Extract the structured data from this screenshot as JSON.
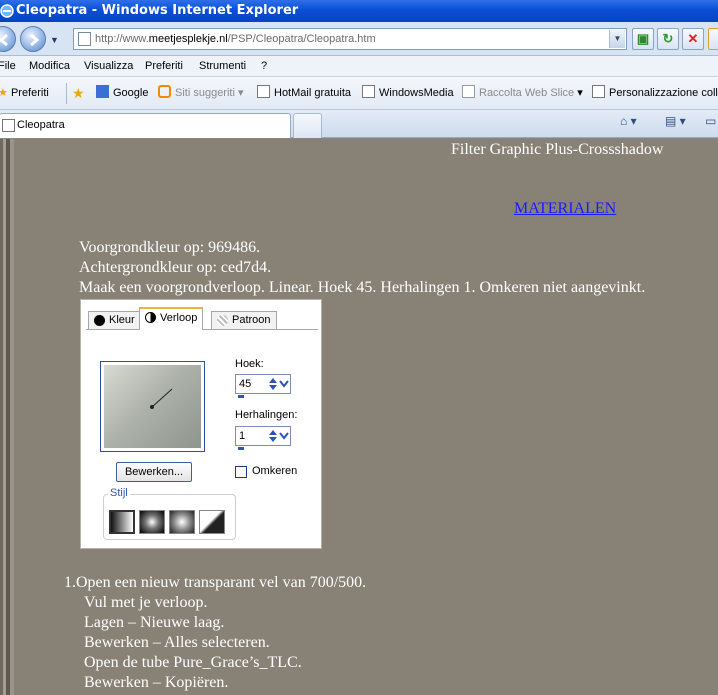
{
  "window": {
    "title": "Cleopatra - Windows Internet Explorer"
  },
  "address": {
    "prefix": "http://www.",
    "host": "meetjesplekje.nl",
    "path": "/PSP/Cleopatra/Cleopatra.htm"
  },
  "menu": [
    "File",
    "Modifica",
    "Visualizza",
    "Preferiti",
    "Strumenti",
    "?"
  ],
  "favorites": {
    "label": "Preferiti",
    "items": [
      "Google",
      "Siti suggeriti",
      "HotMail gratuita",
      "WindowsMedia",
      "Raccolta Web Slice",
      "Personalizzazione colle"
    ]
  },
  "tab": {
    "title": "Cleopatra"
  },
  "page": {
    "header": "Filter Graphic  Plus-Crossshadow",
    "materials_link": "MATERIALEN",
    "intro": [
      "Voorgrondkleur op: 969486.",
      "Achtergrondkleur op: ced7d4.",
      "Maak een voorgrondverloop. Linear. Hoek 45. Herhalingen 1. Omkeren niet aangevinkt."
    ],
    "dialog": {
      "tabs": [
        "Kleur",
        "Verloop",
        "Patroon"
      ],
      "angle_label": "Hoek:",
      "angle_value": "45",
      "repeats_label": "Herhalingen:",
      "repeats_value": "1",
      "edit_button": "Bewerken...",
      "invert_label": "Omkeren",
      "invert_checked": false,
      "style_label": "Stijl",
      "style_selected": "linear"
    },
    "steps": [
      "1.Open een nieuw transparant vel van 700/500.",
      "Vul met je verloop.",
      "Lagen – Nieuwe laag.",
      "Bewerken – Alles selecteren.",
      "Open de tube Pure_Grace’s_TLC.",
      "Bewerken – Kopiëren."
    ]
  },
  "colors": {
    "page_bg": "#878176",
    "foreground": "#969486",
    "background": "#ced7d4",
    "link": "#1a1aff",
    "titlebar": "#0a4fd6"
  }
}
